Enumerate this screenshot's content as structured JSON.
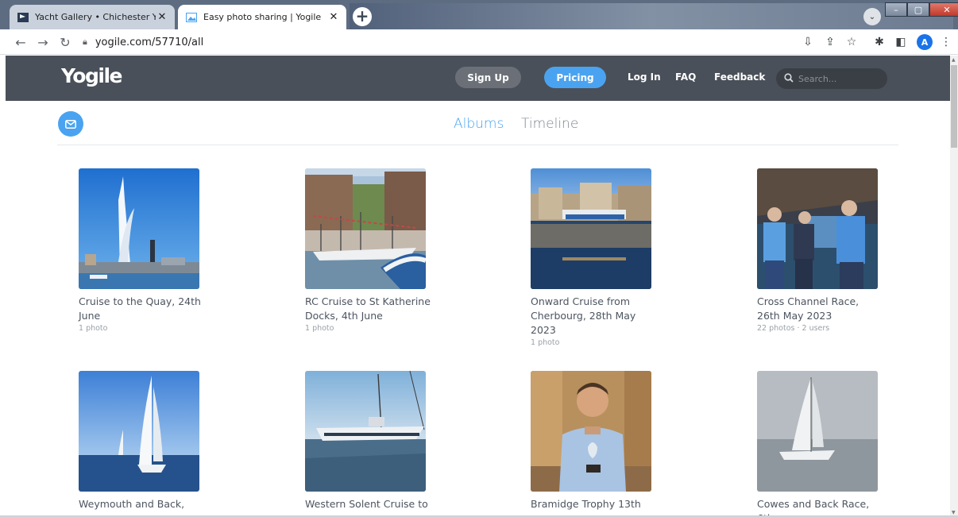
{
  "browser": {
    "tabs": [
      {
        "title": "Yacht Gallery • Chichester Yacht C",
        "active": false
      },
      {
        "title": "Easy photo sharing | Yogile",
        "active": true
      }
    ],
    "new_tab_label": "+",
    "url": "yogile.com/57710/all",
    "profile_initial": "A"
  },
  "site": {
    "logo": "Yogile",
    "nav": {
      "signup": "Sign Up",
      "pricing": "Pricing",
      "login": "Log In",
      "faq": "FAQ",
      "feedback": "Feedback"
    },
    "search_placeholder": "Search...",
    "accent_color": "#4aa3f0",
    "header_color": "#4a5059"
  },
  "view_tabs": {
    "albums": "Albums",
    "timeline": "Timeline",
    "active": "albums"
  },
  "albums": [
    {
      "title": "Cruise to the Quay, 24th June",
      "meta": "1 photo"
    },
    {
      "title": "RC Cruise to St Katherine Docks, 4th June",
      "meta": "1 photo"
    },
    {
      "title": "Onward Cruise from Cherbourg, 28th May 2023",
      "meta": "1 photo"
    },
    {
      "title": "Cross Channel Race, 26th May 2023",
      "meta": "22 photos · 2 users"
    },
    {
      "title": "Weymouth and Back,",
      "meta": ""
    },
    {
      "title": "Western Solent Cruise to",
      "meta": ""
    },
    {
      "title": "Bramidge Trophy 13th",
      "meta": ""
    },
    {
      "title": "Cowes and Back Race, 6th",
      "meta": ""
    }
  ]
}
